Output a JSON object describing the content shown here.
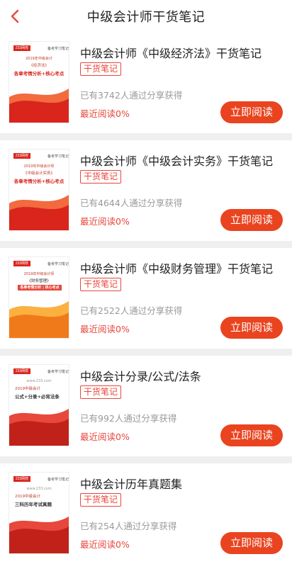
{
  "header": {
    "title": "中级会计师干货笔记"
  },
  "common": {
    "badge": "干货笔记",
    "button": "立即阅读"
  },
  "books": [
    {
      "title": "中级会计师《中级经济法》干货笔记",
      "shares": "已有3742人通过分享获得",
      "recent": "最近阅读0%",
      "cover": {
        "logo": "233网校",
        "tag": "备考学习笔记",
        "line1": "2019年中级会计",
        "line2": "《经济法》",
        "line3": "各章考情分析+核心考点",
        "accent": "#d9251c"
      }
    },
    {
      "title": "中级会计师《中级会计实务》干货笔记",
      "shares": "已有4644人通过分享获得",
      "recent": "最近阅读0%",
      "cover": {
        "logo": "233网校",
        "tag": "备考学习笔记",
        "line1": "2019年中级会计师",
        "line2": "《中级会计实务》",
        "line3": "各章考情分析+核心考点",
        "accent": "#d9251c"
      }
    },
    {
      "title": "中级会计师《中级财务管理》干货笔记",
      "shares": "已有2522人通过分享获得",
      "recent": "最近阅读0%",
      "cover": {
        "logo": "233网校",
        "tag": "备考学习笔记",
        "line1": "2019年中级会计师",
        "line2": "《财务管理》",
        "line3": "各章考情分析 | 核心考点",
        "accent": "#f07a1a"
      }
    },
    {
      "title": "中级会计分录/公式/法条",
      "shares": "已有992人通过分享获得",
      "recent": "最近阅读0%",
      "cover": {
        "logo": "233网校",
        "tag": "备考学习笔记",
        "line1": "www.233.com",
        "line2": "2019中级会计",
        "line3": "公式+分录+必背法条",
        "accent": "#d9251c"
      }
    },
    {
      "title": "中级会计历年真题集",
      "shares": "已有254人通过分享获得",
      "recent": "最近阅读0%",
      "cover": {
        "logo": "233网校",
        "tag": "备考学习笔记",
        "line1": "www.233.com",
        "line2": "2019中级会计",
        "line3": "三科历年考试真题",
        "accent": "#d9251c"
      }
    }
  ]
}
